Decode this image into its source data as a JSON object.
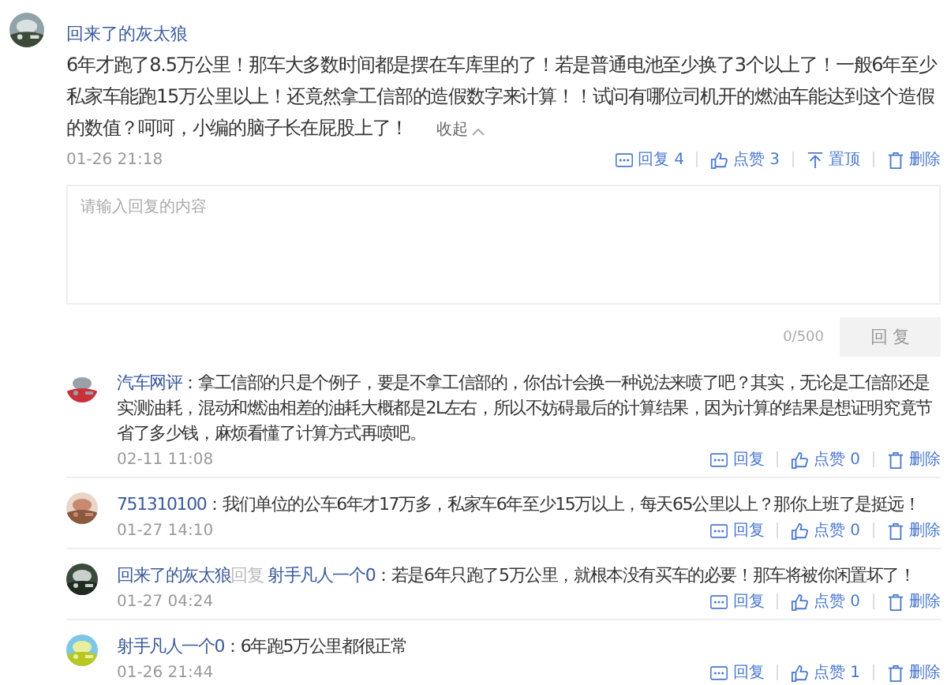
{
  "comment": {
    "author": "回来了的灰太狼",
    "text": "6年才跑了8.5万公里！那车大多数时间都是摆在车库里的了！若是普通电池至少换了3个以上了！一般6年至少私家车能跑15万公里以上！还竟然拿工信部的造假数字来计算！！试问有哪位司机开的燃油车能达到这个造假的数值？呵呵，小编的脑子长在屁股上了！",
    "collapse": "收起",
    "time": "01-26 21:18",
    "actions": [
      {
        "kind": "reply",
        "label": "回复",
        "count": "4"
      },
      {
        "kind": "like",
        "label": "点赞",
        "count": "3"
      },
      {
        "kind": "pin",
        "label": "置顶"
      },
      {
        "kind": "delete",
        "label": "删除"
      }
    ]
  },
  "reply_box": {
    "placeholder": "请输入回复的内容",
    "counter": "0/500",
    "button": "回 复"
  },
  "replies": [
    {
      "author": "汽车网评",
      "text": "：拿工信部的只是个例子，要是不拿工信部的，你估计会换一种说法来喷了吧？其实，无论是工信部还是实测油耗，混动和燃油相差的油耗大概都是2L左右，所以不妨碍最后的计算结果，因为计算的结果是想证明究竟节省了多少钱，麻烦看懂了计算方式再喷吧。",
      "time": "02-11 11:08",
      "actions": [
        {
          "kind": "reply",
          "label": "回复"
        },
        {
          "kind": "like",
          "label": "点赞",
          "count": "0"
        },
        {
          "kind": "delete",
          "label": "删除"
        }
      ]
    },
    {
      "author": "751310100",
      "text": "：我们单位的公车6年才17万多，私家车6年至少15万以上，每天65公里以上？那你上班了是挺远！",
      "time": "01-27 14:10",
      "actions": [
        {
          "kind": "reply",
          "label": "回复"
        },
        {
          "kind": "like",
          "label": "点赞",
          "count": "0"
        },
        {
          "kind": "delete",
          "label": "删除"
        }
      ]
    },
    {
      "author": "回来了的灰太狼",
      "reply_word": "回复",
      "reply_to": "射手凡人一个0",
      "text": "：若是6年只跑了5万公里，就根本没有买车的必要！那车将被你闲置坏了！",
      "time": "01-27 04:24",
      "actions": [
        {
          "kind": "reply",
          "label": "回复"
        },
        {
          "kind": "like",
          "label": "点赞",
          "count": "0"
        },
        {
          "kind": "delete",
          "label": "删除"
        }
      ]
    },
    {
      "author": "射手凡人一个0",
      "text": "：6年跑5万公里都很正常",
      "time": "01-26 21:44",
      "actions": [
        {
          "kind": "reply",
          "label": "回复"
        },
        {
          "kind": "like",
          "label": "点赞",
          "count": "1"
        },
        {
          "kind": "delete",
          "label": "删除"
        }
      ]
    }
  ]
}
